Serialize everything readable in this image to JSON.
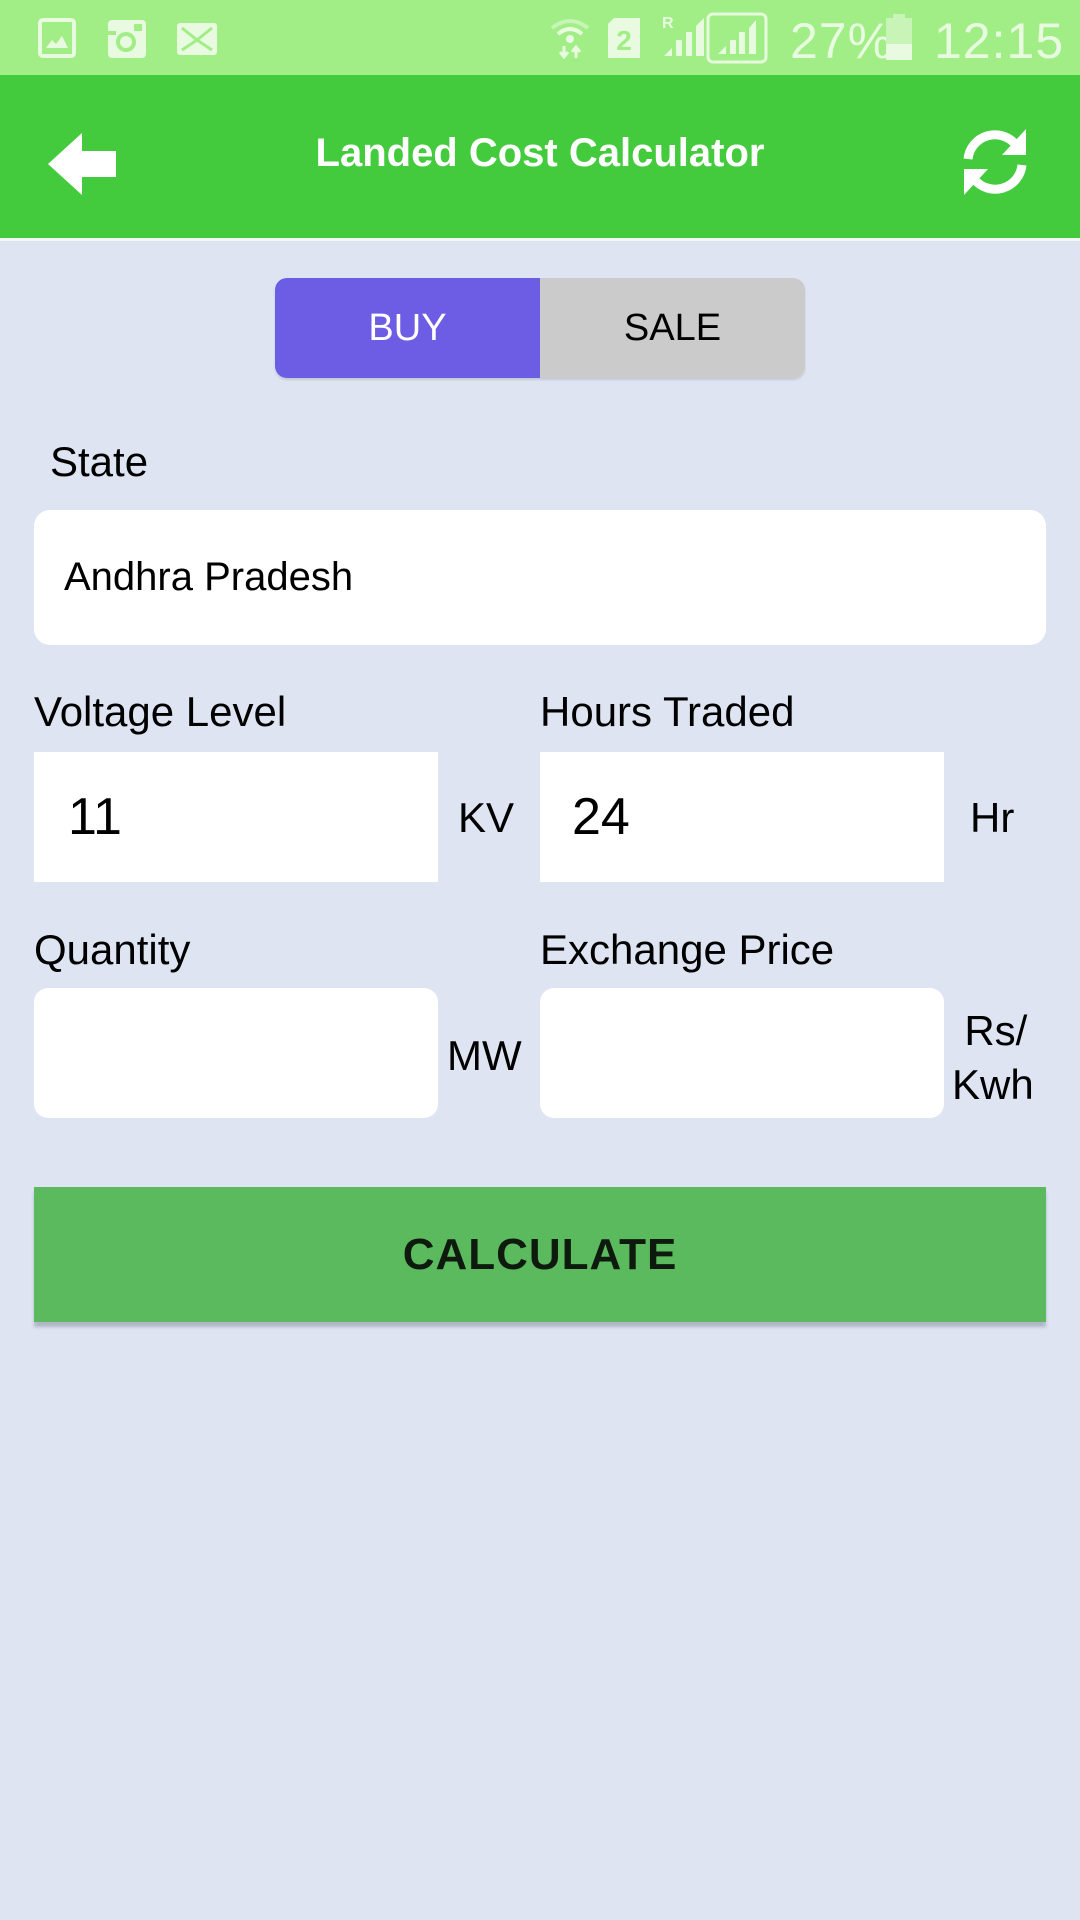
{
  "status_bar": {
    "notification_icons": [
      "gallery-icon",
      "instagram-icon",
      "mail-icon"
    ],
    "system_icons": [
      "wifi-data-icon",
      "sim-2-icon",
      "roaming-signal-icon",
      "signal-icon"
    ],
    "battery_percent": "27%",
    "battery_level": 0.27,
    "time": "12:15"
  },
  "app_bar": {
    "title": "Landed Cost Calculator",
    "back_icon": "arrow-left-icon",
    "refresh_icon": "refresh-icon",
    "color": "#43cb3d"
  },
  "mode_toggle": {
    "options": [
      {
        "label": "BUY",
        "selected": true
      },
      {
        "label": "SALE",
        "selected": false
      }
    ],
    "selected_color": "#6d5de4",
    "unselected_color": "#cbcbcb"
  },
  "form": {
    "state": {
      "label": "State",
      "value": "Andhra Pradesh"
    },
    "voltage_level": {
      "label": "Voltage Level",
      "value": "11",
      "unit": "KV"
    },
    "hours_traded": {
      "label": "Hours Traded",
      "value": "24",
      "unit": "Hr"
    },
    "quantity": {
      "label": "Quantity",
      "value": "",
      "unit": "MW"
    },
    "exchange_price": {
      "label": "Exchange Price",
      "value": "",
      "unit_line1": "Rs/",
      "unit_line2": "Kwh"
    }
  },
  "calculate_button": {
    "label": "CALCULATE",
    "color": "#5cba5e"
  }
}
